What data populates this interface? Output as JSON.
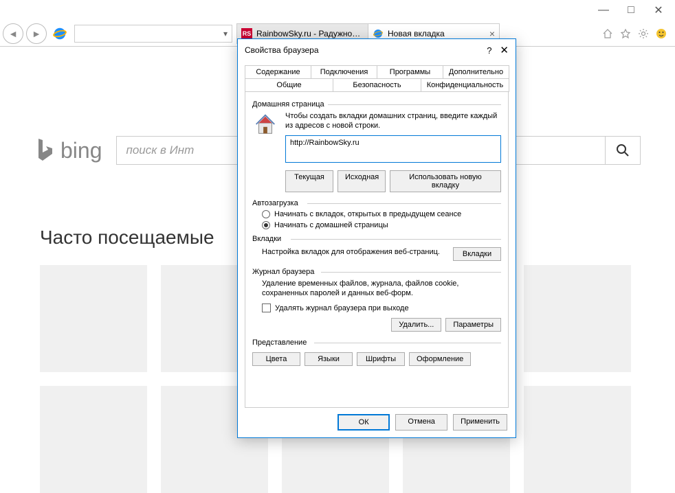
{
  "window": {
    "minimize": "—",
    "maximize": "□",
    "close": "✕"
  },
  "nav": {
    "tabs": [
      {
        "label": "RainbowSky.ru - Радужное Не..."
      },
      {
        "label": "Новая вкладка"
      }
    ]
  },
  "page": {
    "bing_label": "bing",
    "search_placeholder": "поиск в Инт",
    "frequent_heading": "Часто посещаемые"
  },
  "dialog": {
    "title": "Свойства браузера",
    "tabs_top": [
      "Содержание",
      "Подключения",
      "Программы",
      "Дополнительно"
    ],
    "tabs_bottom": [
      "Общие",
      "Безопасность",
      "Конфиденциальность"
    ],
    "home": {
      "label": "Домашняя страница",
      "text": "Чтобы создать вкладки домашних страниц, введите каждый из адресов с новой строки.",
      "value": "http://RainbowSky.ru",
      "btn_current": "Текущая",
      "btn_default": "Исходная",
      "btn_newtab": "Использовать новую вкладку"
    },
    "autoload": {
      "label": "Автозагрузка",
      "opt1": "Начинать с вкладок, открытых в предыдущем сеансе",
      "opt2": "Начинать с домашней страницы"
    },
    "tabs_section": {
      "label": "Вкладки",
      "text": "Настройка вкладок для отображения веб-страниц.",
      "btn": "Вкладки"
    },
    "journal": {
      "label": "Журнал браузера",
      "text": "Удаление временных файлов, журнала, файлов cookie, сохраненных паролей и данных веб-форм.",
      "check": "Удалять журнал браузера при выходе",
      "btn_delete": "Удалить...",
      "btn_params": "Параметры"
    },
    "presentation": {
      "label": "Представление",
      "btn_colors": "Цвета",
      "btn_langs": "Языки",
      "btn_fonts": "Шрифты",
      "btn_style": "Оформление"
    },
    "footer": {
      "ok": "ОК",
      "cancel": "Отмена",
      "apply": "Применить"
    }
  }
}
